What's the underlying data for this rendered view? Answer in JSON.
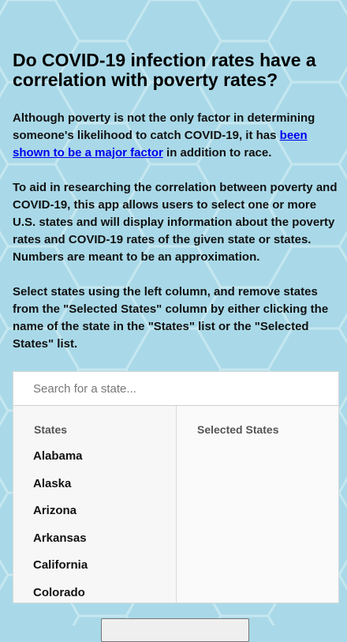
{
  "heading": "Do COVID-19 infection rates have a correlation with poverty rates?",
  "intro": {
    "before_link": "Although poverty is not the only factor in determining someone's likelihood to catch COVID-19, it has ",
    "link_text": "been shown to be a major factor",
    "after_link": " in addition to race."
  },
  "description": "To aid in researching the correlation between poverty and COVID-19, this app allows users to select one or more U.S. states and will display information about the poverty rates and COVID-19 rates of the given state or states. Numbers are meant to be an approximation.",
  "instructions": "Select states using the left column, and remove states from the \"Selected States\" column by either clicking the name of the state in the \"States\" list or the \"Selected States\" list.",
  "search": {
    "placeholder": "Search for a state...",
    "value": ""
  },
  "states_column": {
    "header": "States",
    "items": [
      "Alabama",
      "Alaska",
      "Arizona",
      "Arkansas",
      "California",
      "Colorado"
    ]
  },
  "selected_column": {
    "header": "Selected States",
    "items": []
  },
  "colors": {
    "background": "#a9d9e8",
    "hex_lines": "#c5e6ef",
    "link": "#0000ee"
  }
}
